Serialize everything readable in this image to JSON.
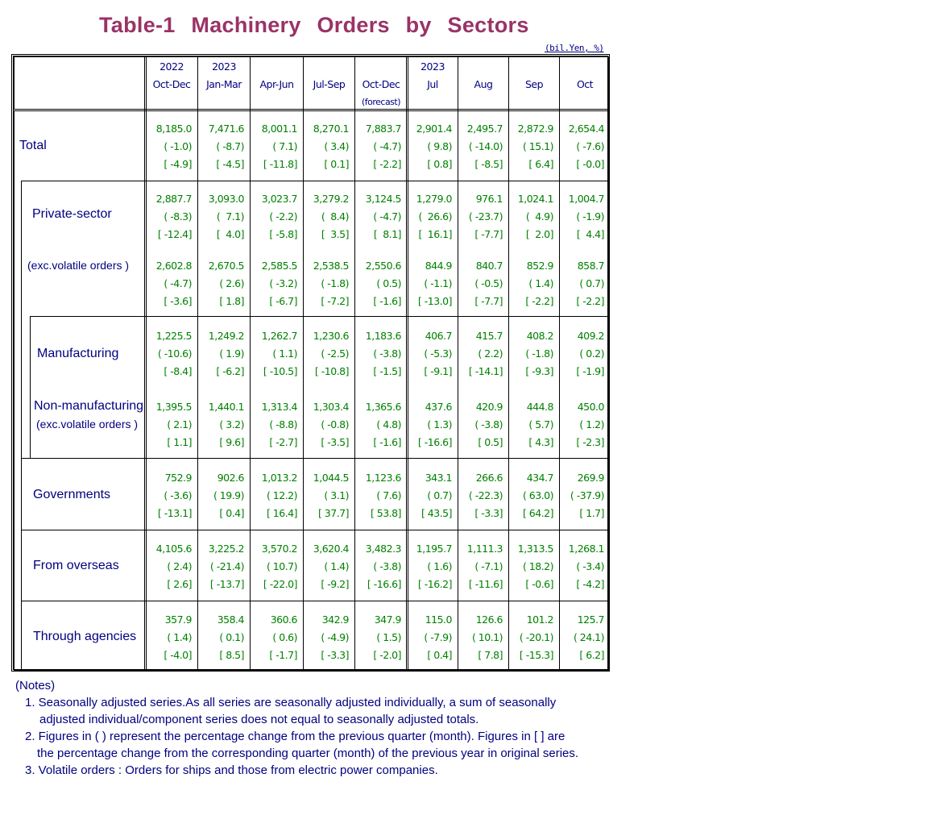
{
  "title": "Table-1  Machinery  Orders  by  Sectors",
  "unit": "(bil.Yen, %)",
  "columns": [
    {
      "year": "2022",
      "period": "Oct-Dec",
      "note": ""
    },
    {
      "year": "2023",
      "period": "Jan-Mar",
      "note": ""
    },
    {
      "year": "",
      "period": "Apr-Jun",
      "note": ""
    },
    {
      "year": "",
      "period": "Jul-Sep",
      "note": ""
    },
    {
      "year": "",
      "period": "Oct-Dec",
      "note": "(forecast)"
    },
    {
      "year": "2023",
      "period": "Jul",
      "note": ""
    },
    {
      "year": "",
      "period": "Aug",
      "note": ""
    },
    {
      "year": "",
      "period": "Sep",
      "note": ""
    },
    {
      "year": "",
      "period": "Oct",
      "note": ""
    }
  ],
  "rows": [
    {
      "label": "Total",
      "sublabel": "",
      "values": [
        [
          "8,185.0",
          "( -1.0)",
          "[ -4.9]"
        ],
        [
          "7,471.6",
          "( -8.7)",
          "[ -4.5]"
        ],
        [
          "8,001.1",
          "( 7.1)",
          "[ -11.8]"
        ],
        [
          "8,270.1",
          "( 3.4)",
          "[ 0.1]"
        ],
        [
          "7,883.7",
          "( -4.7)",
          "[ -2.2]"
        ],
        [
          "2,901.4",
          "( 9.8)",
          "[ 0.8]"
        ],
        [
          "2,495.7",
          "( -14.0)",
          "[ -8.5]"
        ],
        [
          "2,872.9",
          "( 15.1)",
          "[ 6.4]"
        ],
        [
          "2,654.4",
          "( -7.6)",
          "[ -0.0]"
        ]
      ]
    },
    {
      "label": "Private-sector",
      "sublabel": "",
      "values": [
        [
          "2,887.7",
          "( -8.3)",
          "[ -12.4]"
        ],
        [
          "3,093.0",
          "(  7.1)",
          "[  4.0]"
        ],
        [
          "3,023.7",
          "( -2.2)",
          "[ -5.8]"
        ],
        [
          "3,279.2",
          "(  8.4)",
          "[  3.5]"
        ],
        [
          "3,124.5",
          "( -4.7)",
          "[  8.1]"
        ],
        [
          "1,279.0",
          "(  26.6)",
          "[  16.1]"
        ],
        [
          "976.1",
          "( -23.7)",
          "[ -7.7]"
        ],
        [
          "1,024.1",
          "(  4.9)",
          "[  2.0]"
        ],
        [
          "1,004.7",
          "( -1.9)",
          "[  4.4]"
        ]
      ]
    },
    {
      "label": "(exc.volatile orders )",
      "sublabel": "",
      "values": [
        [
          "2,602.8",
          "( -4.7)",
          "[ -3.6]"
        ],
        [
          "2,670.5",
          "( 2.6)",
          "[ 1.8]"
        ],
        [
          "2,585.5",
          "( -3.2)",
          "[ -6.7]"
        ],
        [
          "2,538.5",
          "( -1.8)",
          "[ -7.2]"
        ],
        [
          "2,550.6",
          "( 0.5)",
          "[ -1.6]"
        ],
        [
          "844.9",
          "( -1.1)",
          "[ -13.0]"
        ],
        [
          "840.7",
          "( -0.5)",
          "[ -7.7]"
        ],
        [
          "852.9",
          "( 1.4)",
          "[ -2.2]"
        ],
        [
          "858.7",
          "( 0.7)",
          "[ -2.2]"
        ]
      ]
    },
    {
      "label": "Manufacturing",
      "sublabel": "",
      "values": [
        [
          "1,225.5",
          "( -10.6)",
          "[ -8.4]"
        ],
        [
          "1,249.2",
          "( 1.9)",
          "[ -6.2]"
        ],
        [
          "1,262.7",
          "( 1.1)",
          "[ -10.5]"
        ],
        [
          "1,230.6",
          "( -2.5)",
          "[ -10.8]"
        ],
        [
          "1,183.6",
          "( -3.8)",
          "[ -1.5]"
        ],
        [
          "406.7",
          "( -5.3)",
          "[ -9.1]"
        ],
        [
          "415.7",
          "( 2.2)",
          "[ -14.1]"
        ],
        [
          "408.2",
          "( -1.8)",
          "[ -9.3]"
        ],
        [
          "409.2",
          "( 0.2)",
          "[ -1.9]"
        ]
      ]
    },
    {
      "label": "Non-manufacturing",
      "sublabel": "(exc.volatile orders )",
      "values": [
        [
          "1,395.5",
          "( 2.1)",
          "[ 1.1]"
        ],
        [
          "1,440.1",
          "( 3.2)",
          "[ 9.6]"
        ],
        [
          "1,313.4",
          "( -8.8)",
          "[ -2.7]"
        ],
        [
          "1,303.4",
          "( -0.8)",
          "[ -3.5]"
        ],
        [
          "1,365.6",
          "( 4.8)",
          "[ -1.6]"
        ],
        [
          "437.6",
          "( 1.3)",
          "[ -16.6]"
        ],
        [
          "420.9",
          "( -3.8)",
          "[ 0.5]"
        ],
        [
          "444.8",
          "( 5.7)",
          "[ 4.3]"
        ],
        [
          "450.0",
          "( 1.2)",
          "[ -2.3]"
        ]
      ]
    },
    {
      "label": "Governments",
      "sublabel": "",
      "values": [
        [
          "752.9",
          "( -3.6)",
          "[ -13.1]"
        ],
        [
          "902.6",
          "( 19.9)",
          "[ 0.4]"
        ],
        [
          "1,013.2",
          "( 12.2)",
          "[ 16.4]"
        ],
        [
          "1,044.5",
          "( 3.1)",
          "[ 37.7]"
        ],
        [
          "1,123.6",
          "( 7.6)",
          "[ 53.8]"
        ],
        [
          "343.1",
          "( 0.7)",
          "[ 43.5]"
        ],
        [
          "266.6",
          "( -22.3)",
          "[ -3.3]"
        ],
        [
          "434.7",
          "( 63.0)",
          "[ 64.2]"
        ],
        [
          "269.9",
          "( -37.9)",
          "[ 1.7]"
        ]
      ]
    },
    {
      "label": "From overseas",
      "sublabel": "",
      "values": [
        [
          "4,105.6",
          "( 2.4)",
          "[ 2.6]"
        ],
        [
          "3,225.2",
          "( -21.4)",
          "[ -13.7]"
        ],
        [
          "3,570.2",
          "( 10.7)",
          "[ -22.0]"
        ],
        [
          "3,620.4",
          "( 1.4)",
          "[ -9.2]"
        ],
        [
          "3,482.3",
          "( -3.8)",
          "[ -16.6]"
        ],
        [
          "1,195.7",
          "( 1.6)",
          "[ -16.2]"
        ],
        [
          "1,111.3",
          "( -7.1)",
          "[ -11.6]"
        ],
        [
          "1,313.5",
          "( 18.2)",
          "[ -0.6]"
        ],
        [
          "1,268.1",
          "( -3.4)",
          "[ -4.2]"
        ]
      ]
    },
    {
      "label": "Through agencies",
      "sublabel": "",
      "values": [
        [
          "357.9",
          "( 1.4)",
          "[ -4.0]"
        ],
        [
          "358.4",
          "( 0.1)",
          "[ 8.5]"
        ],
        [
          "360.6",
          "( 0.6)",
          "[ -1.7]"
        ],
        [
          "342.9",
          "( -4.9)",
          "[ -3.3]"
        ],
        [
          "347.9",
          "( 1.5)",
          "[ -2.0]"
        ],
        [
          "115.0",
          "( -7.9)",
          "[ 0.4]"
        ],
        [
          "126.6",
          "( 10.1)",
          "[ 7.8]"
        ],
        [
          "101.2",
          "( -20.1)",
          "[ -15.3]"
        ],
        [
          "125.7",
          "( 24.1)",
          "[ 6.2]"
        ]
      ]
    }
  ],
  "notes": {
    "heading": "(Notes)",
    "items": [
      "1. Seasonally adjusted series.As all series are seasonally adjusted individually, a sum of seasonally",
      "adjusted individual/component series does not equal to seasonally adjusted totals.",
      "2. Figures in ( ) represent the percentage change from the previous quarter (month). Figures in [ ] are",
      "the percentage change from the corresponding quarter (month) of the previous year in original series.",
      "3. Volatile orders : Orders for ships and those from electric power companies."
    ]
  },
  "colors": {
    "title": "#993366",
    "text": "#000080",
    "values": "#008000",
    "border": "#000000"
  }
}
